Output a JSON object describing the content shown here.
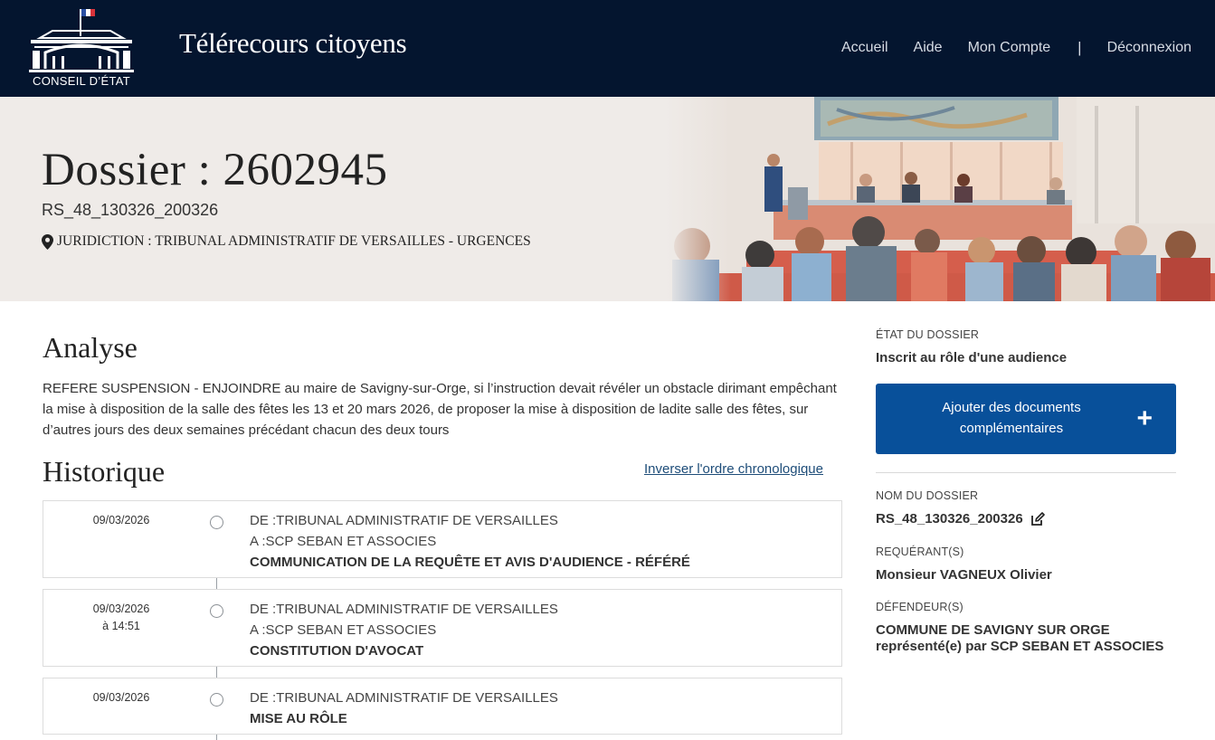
{
  "header": {
    "logo_text": "CONSEIL D’ÉTAT",
    "app_title": "Télérecours citoyens",
    "nav": {
      "home": "Accueil",
      "help": "Aide",
      "account": "Mon Compte",
      "separator": "|",
      "logout": "Déconnexion"
    }
  },
  "banner": {
    "title": "Dossier : 2602945",
    "reference": "RS_48_130326_200326",
    "juridiction": "JURIDICTION : TRIBUNAL ADMINISTRATIF DE VERSAILLES - URGENCES"
  },
  "analyse": {
    "heading": "Analyse",
    "text": "REFERE SUSPENSION - ENJOINDRE au maire de Savigny-sur-Orge, si l’instruction devait révéler un obstacle dirimant empêchant la mise à disposition de la salle des fêtes les 13 et 20 mars 2026, de proposer la mise à disposition de ladite salle des fêtes, sur d’autres jours des deux semaines précédant chacun des deux tours"
  },
  "historique": {
    "heading": "Historique",
    "invert_link": "Inverser l'ordre chronologique",
    "events": [
      {
        "date": "09/03/2026",
        "time": "",
        "from": "DE :TRIBUNAL ADMINISTRATIF DE VERSAILLES",
        "to": "A :SCP SEBAN ET ASSOCIES",
        "title": "COMMUNICATION DE LA REQUÊTE ET AVIS D'AUDIENCE - RÉFÉRÉ"
      },
      {
        "date": "09/03/2026",
        "time": "à 14:51",
        "from": "DE :TRIBUNAL ADMINISTRATIF DE VERSAILLES",
        "to": "A :SCP SEBAN ET ASSOCIES",
        "title": "CONSTITUTION D'AVOCAT"
      },
      {
        "date": "09/03/2026",
        "time": "",
        "from": "DE :TRIBUNAL ADMINISTRATIF DE VERSAILLES",
        "to": "",
        "title": "MISE AU RÔLE"
      }
    ]
  },
  "sidebar": {
    "etat_label": "ÉTAT DU DOSSIER",
    "etat_value": "Inscrit au rôle d'une audience",
    "add_button_line1": "Ajouter des documents",
    "add_button_line2": "complémentaires",
    "add_button_icon": "+",
    "nom_label": "NOM DU DOSSIER",
    "nom_value": "RS_48_130326_200326",
    "requerant_label": "REQUÉRANT(S)",
    "requerant_value": "Monsieur VAGNEUX Olivier",
    "defendeur_label": "DÉFENDEUR(S)",
    "defendeur_line1": "COMMUNE DE SAVIGNY SUR ORGE",
    "defendeur_line2": "représenté(e) par SCP SEBAN ET ASSOCIES"
  },
  "colors": {
    "header_bg": "#04152f",
    "banner_bg": "#efebe8",
    "primary_button": "#08509a",
    "link": "#1e4d79"
  },
  "icons": {
    "logo": "conseil-etat-building-logo",
    "location": "map-marker-icon",
    "edit": "edit-icon",
    "plus": "plus-icon"
  }
}
